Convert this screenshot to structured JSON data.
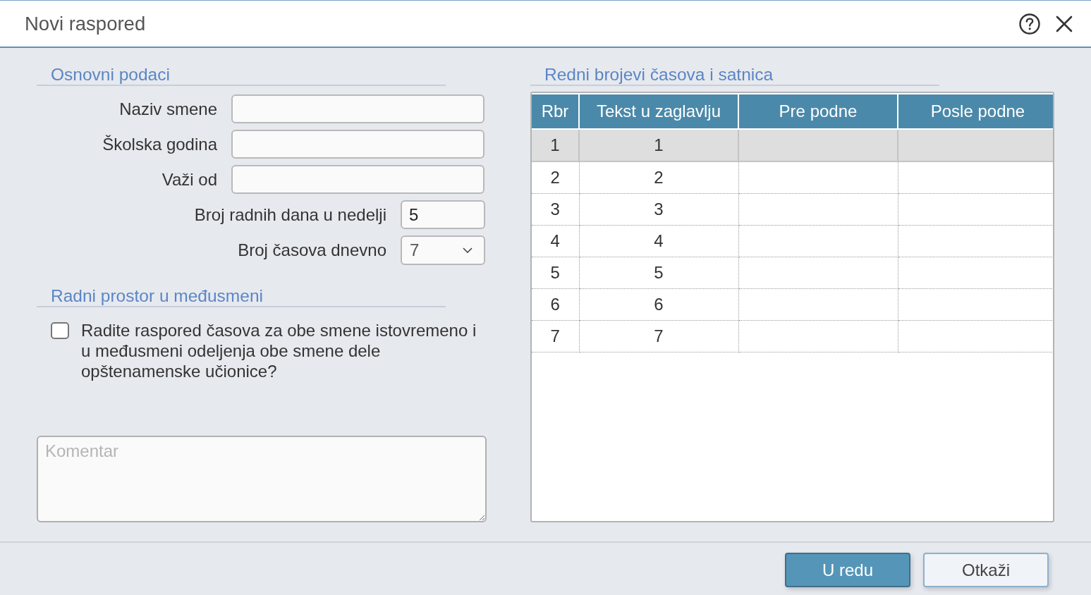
{
  "window": {
    "title": "Novi raspored"
  },
  "basic_data": {
    "heading": "Osnovni podaci",
    "fields": [
      {
        "label": "Naziv smene",
        "kind": "text"
      },
      {
        "label": "Školska godina",
        "kind": "text"
      },
      {
        "label": "Važi od",
        "kind": "text"
      },
      {
        "label": "Broj radnih dana u nedelji",
        "kind": "number",
        "value": "5"
      },
      {
        "label": "Broj časova dnevno",
        "kind": "select",
        "value": "7"
      }
    ]
  },
  "shift_workspace": {
    "heading": "Radni prostor u međusmeni",
    "checkbox": {
      "label": "Radite raspored časova za obe smene istovremeno i u međusmeni odeljenja obe smene dele opštenamenske učionice?",
      "checked": false
    }
  },
  "comment": {
    "placeholder": "Komentar"
  },
  "schedule": {
    "heading": "Redni brojevi časova i satnica",
    "table": {
      "columns": [
        "Rbr",
        "Tekst u zaglavlju",
        "Pre podne",
        "Posle podne"
      ],
      "rows": [
        {
          "cells": [
            "1",
            "1"
          ],
          "selected": true
        },
        {
          "cells": [
            "2",
            "2"
          ],
          "selected": false
        },
        {
          "cells": [
            "3",
            "3"
          ],
          "selected": false
        },
        {
          "cells": [
            "4",
            "4"
          ],
          "selected": false
        },
        {
          "cells": [
            "5",
            "5"
          ],
          "selected": false
        },
        {
          "cells": [
            "6",
            "6"
          ],
          "selected": false
        },
        {
          "cells": [
            "7",
            "7"
          ],
          "selected": false
        }
      ]
    }
  },
  "buttons": [
    {
      "label": "U redu",
      "kind": "primary"
    },
    {
      "label": "Otkaži",
      "kind": "secondary"
    }
  ]
}
